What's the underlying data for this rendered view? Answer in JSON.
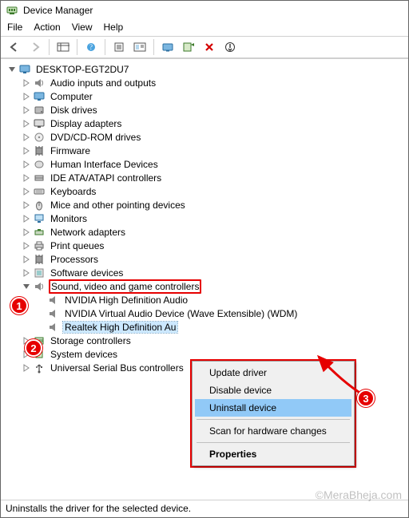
{
  "window": {
    "title": "Device Manager"
  },
  "menu": {
    "file": "File",
    "action": "Action",
    "view": "View",
    "help": "Help"
  },
  "toolbar": {
    "back": "back-icon",
    "forward": "forward-icon",
    "show_hide": "show-hide-icon",
    "help": "help-icon",
    "properties": "properties-icon",
    "console": "console-icon",
    "computer": "computer-monitor-icon",
    "scan": "scan-hardware-icon",
    "remove": "remove-icon",
    "update": "update-driver-icon"
  },
  "tree": {
    "root": {
      "label": "DESKTOP-EGT2DU7",
      "expanded": true
    },
    "items": [
      {
        "label": "Audio inputs and outputs",
        "icon": "speaker"
      },
      {
        "label": "Computer",
        "icon": "computer"
      },
      {
        "label": "Disk drives",
        "icon": "disk"
      },
      {
        "label": "Display adapters",
        "icon": "display"
      },
      {
        "label": "DVD/CD-ROM drives",
        "icon": "cd"
      },
      {
        "label": "Firmware",
        "icon": "chip"
      },
      {
        "label": "Human Interface Devices",
        "icon": "hid"
      },
      {
        "label": "IDE ATA/ATAPI controllers",
        "icon": "ide"
      },
      {
        "label": "Keyboards",
        "icon": "keyboard"
      },
      {
        "label": "Mice and other pointing devices",
        "icon": "mouse"
      },
      {
        "label": "Monitors",
        "icon": "monitor"
      },
      {
        "label": "Network adapters",
        "icon": "network"
      },
      {
        "label": "Print queues",
        "icon": "printer"
      },
      {
        "label": "Processors",
        "icon": "cpu"
      },
      {
        "label": "Software devices",
        "icon": "sw"
      }
    ],
    "sound": {
      "label": "Sound, video and game controllers",
      "children": [
        {
          "label": "NVIDIA High Definition Audio"
        },
        {
          "label": "NVIDIA Virtual Audio Device (Wave Extensible) (WDM)"
        },
        {
          "label": "Realtek High Definition Au",
          "selected": true
        }
      ]
    },
    "rest": [
      {
        "label": "Storage controllers",
        "icon": "storage"
      },
      {
        "label": "System devices",
        "icon": "system"
      },
      {
        "label": "Universal Serial Bus controllers",
        "icon": "usb"
      }
    ]
  },
  "context_menu": {
    "update": "Update driver",
    "disable": "Disable device",
    "uninstall": "Uninstall device",
    "scan": "Scan for hardware changes",
    "properties": "Properties"
  },
  "status": "Uninstalls the driver for the selected device.",
  "annotations": {
    "b1": "1",
    "b2": "2",
    "b3": "3"
  },
  "watermark": "©MeraBheja.com"
}
